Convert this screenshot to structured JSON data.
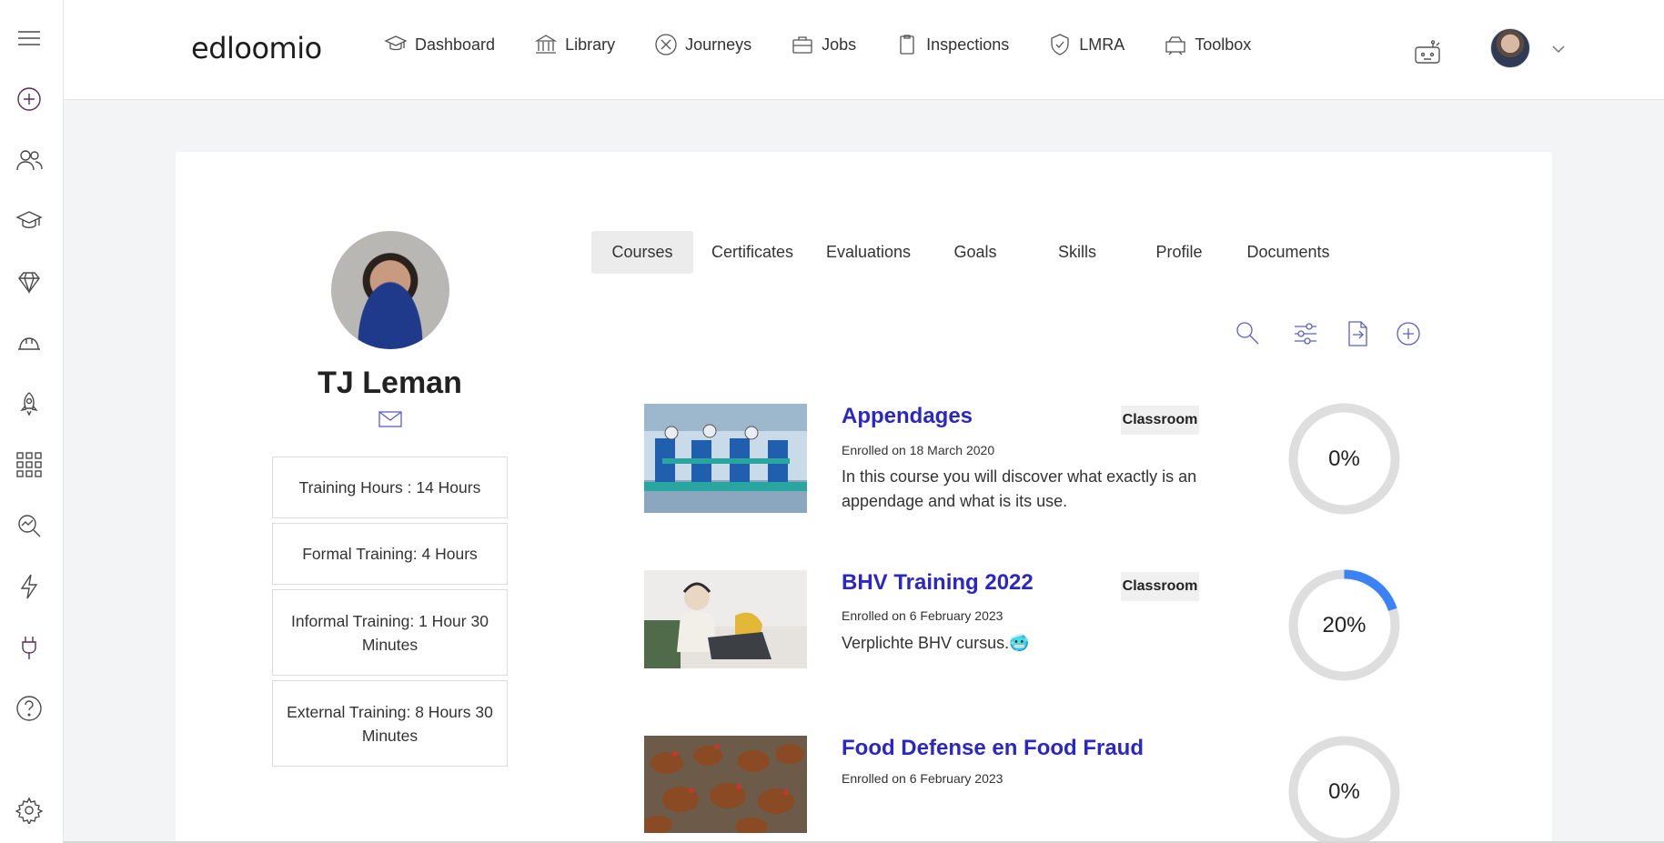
{
  "brand": {
    "logo_text": "edloomio",
    "accent": "#2a27c4",
    "icon_color": "#5b5fc7",
    "progress_color": "#3b82f6"
  },
  "sidebar": {
    "items": [
      {
        "icon": "add-circle-icon"
      },
      {
        "icon": "users-icon"
      },
      {
        "icon": "graduation-cap-icon"
      },
      {
        "icon": "diamond-icon"
      },
      {
        "icon": "hard-hat-icon"
      },
      {
        "icon": "rocket-icon"
      },
      {
        "icon": "apps-grid-icon"
      },
      {
        "icon": "analytics-search-icon"
      },
      {
        "icon": "lightning-icon"
      },
      {
        "icon": "plug-icon"
      },
      {
        "icon": "help-icon"
      },
      {
        "icon": "settings-gear-icon"
      }
    ]
  },
  "nav": {
    "items": [
      {
        "label": "Dashboard",
        "icon": "graduation-cap-icon"
      },
      {
        "label": "Library",
        "icon": "library-building-icon"
      },
      {
        "label": "Journeys",
        "icon": "compass-icon"
      },
      {
        "label": "Jobs",
        "icon": "briefcase-icon"
      },
      {
        "label": "Inspections",
        "icon": "clipboard-icon"
      },
      {
        "label": "LMRA",
        "icon": "shield-check-icon"
      },
      {
        "label": "Toolbox",
        "icon": "toolbox-icon"
      }
    ]
  },
  "profile": {
    "name": "TJ Leman",
    "stats": [
      "Training Hours : 14 Hours",
      "Formal Training: 4 Hours",
      "Informal Training: 1 Hour 30 Minutes",
      "External Training: 8 Hours 30 Minutes"
    ]
  },
  "tabs": [
    {
      "label": "Courses",
      "active": true
    },
    {
      "label": "Certificates",
      "active": false
    },
    {
      "label": "Evaluations",
      "active": false
    },
    {
      "label": "Goals",
      "active": false
    },
    {
      "label": "Skills",
      "active": false
    },
    {
      "label": "Profile",
      "active": false
    },
    {
      "label": "Documents",
      "active": false
    }
  ],
  "toolbar": {
    "icons": [
      "search-icon",
      "filter-sliders-icon",
      "export-file-icon",
      "add-circle-icon"
    ]
  },
  "courses": [
    {
      "title": "Appendages",
      "badge": "Classroom",
      "enrolled": "Enrolled on 18 March 2020",
      "description": "In this course you will discover what exactly is an appendage and what is its use.",
      "progress": 0,
      "progress_label": "0%"
    },
    {
      "title": "BHV Training 2022",
      "badge": "Classroom",
      "enrolled": "Enrolled on 6 February 2023",
      "description": "Verplichte BHV cursus.🥶",
      "progress": 20,
      "progress_label": "20%"
    },
    {
      "title": "Food Defense en Food Fraud",
      "badge": "",
      "enrolled": "Enrolled on 6 February 2023",
      "description": "",
      "progress": 0,
      "progress_label": "0%"
    }
  ]
}
